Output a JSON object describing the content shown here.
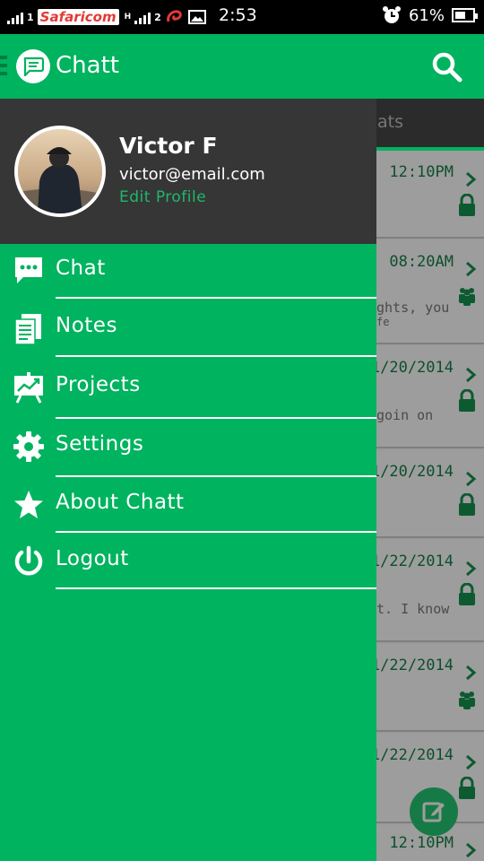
{
  "status_bar": {
    "carrier": "Safaricom",
    "sim1": "1",
    "sim2": "2",
    "network_type": "H",
    "time": "2:53",
    "battery": "61%"
  },
  "app_bar": {
    "title": "Chatt",
    "logo_icon": "chat-bubble-icon",
    "search_icon": "search-icon",
    "menu_icon": "hamburger-icon"
  },
  "background": {
    "tab_label": "ats",
    "rows": [
      {
        "time": "12:10PM",
        "preview": "",
        "status_icon": "lock-icon"
      },
      {
        "time": "08:20AM",
        "preview": "ghts, you",
        "preview2": "fe",
        "status_icon": "group-icon"
      },
      {
        "time": "1/20/2014",
        "preview": "goin on",
        "status_icon": "lock-icon"
      },
      {
        "time": "1/20/2014",
        "preview": "",
        "status_icon": "lock-icon"
      },
      {
        "time": "1/22/2014",
        "preview": "t. I know",
        "status_icon": "lock-icon"
      },
      {
        "time": "1/22/2014",
        "preview": "",
        "status_icon": "group-icon"
      },
      {
        "time": "1/22/2014",
        "preview": "",
        "status_icon": "lock-icon"
      },
      {
        "time": "12:10PM",
        "preview": "",
        "status_icon": "none"
      }
    ],
    "fab_icon": "compose-icon"
  },
  "drawer": {
    "profile": {
      "name": "Victor F",
      "email": "victor@email.com",
      "edit_label": "Edit Profile"
    },
    "items": [
      {
        "label": "Chat",
        "icon": "chat-icon"
      },
      {
        "label": "Notes",
        "icon": "notes-icon"
      },
      {
        "label": "Projects",
        "icon": "projects-icon"
      },
      {
        "label": "Settings",
        "icon": "gear-icon"
      },
      {
        "label": "About Chatt",
        "icon": "star-icon"
      },
      {
        "label": "Logout",
        "icon": "power-icon"
      }
    ]
  },
  "colors": {
    "brand_green": "#00b35f",
    "drawer_header": "#363636",
    "dim_overlay_row": "#9d9d9d"
  }
}
